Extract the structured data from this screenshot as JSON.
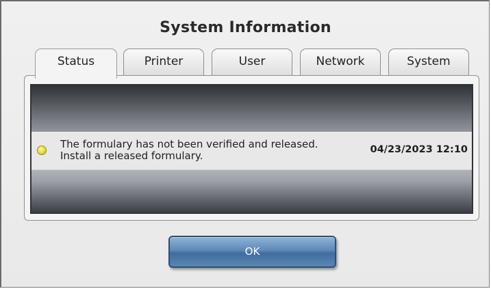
{
  "dialog": {
    "title": "System Information"
  },
  "tabs": [
    {
      "label": "Status",
      "active": true
    },
    {
      "label": "Printer",
      "active": false
    },
    {
      "label": "User",
      "active": false
    },
    {
      "label": "Network",
      "active": false
    },
    {
      "label": "System",
      "active": false
    }
  ],
  "status": {
    "items": [
      {
        "indicator": "yellow-status-dot",
        "indicator_color": "#e6dc3c",
        "message": "The formulary has not been verified and released. Install a released formulary.",
        "timestamp": "04/23/2023 12:10"
      }
    ]
  },
  "buttons": {
    "ok_label": "OK"
  }
}
